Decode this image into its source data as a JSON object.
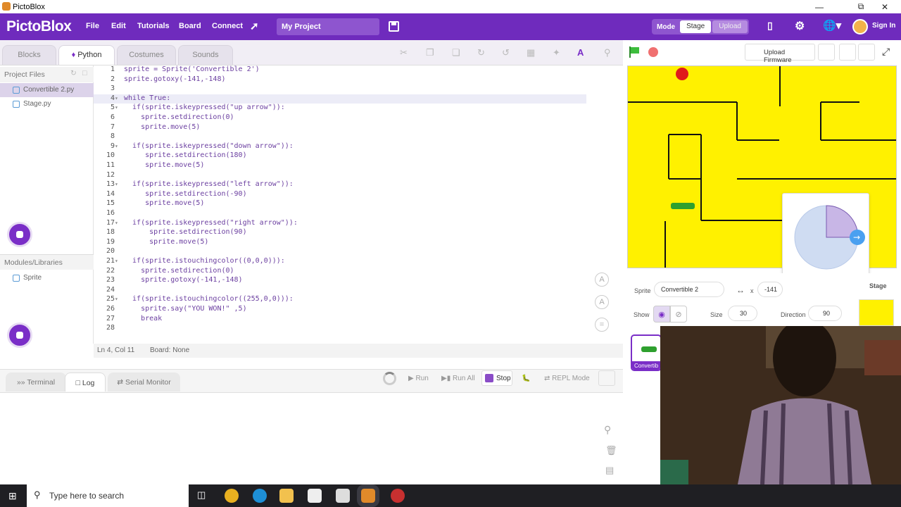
{
  "window": {
    "title": "PictoBlox"
  },
  "menubar": {
    "logo": "PictoBlox",
    "items": [
      "File",
      "Edit",
      "Tutorials",
      "Board",
      "Connect"
    ],
    "project_name": "My Project",
    "mode_label": "Mode",
    "mode_stage": "Stage",
    "mode_upload": "Upload",
    "sign_in": "Sign In"
  },
  "tabs": [
    "Blocks",
    "Python",
    "Costumes",
    "Sounds"
  ],
  "toolbar": {
    "upload_firmware": "Upload Firmware"
  },
  "file_panel": {
    "project_files_header": "Project Files",
    "files": [
      "Convertible 2.py",
      "Stage.py"
    ],
    "modules_header": "Modules/Libraries",
    "modules": [
      "Sprite"
    ]
  },
  "editor": {
    "lines": [
      "sprite = Sprite('Convertible 2')",
      "sprite.gotoxy(-141,-148)",
      "",
      "while True:",
      "  if(sprite.iskeypressed(\"up arrow\")):",
      "    sprite.setdirection(0)",
      "    sprite.move(5)",
      "",
      "  if(sprite.iskeypressed(\"down arrow\")):",
      "     sprite.setdirection(180)",
      "     sprite.move(5)",
      "",
      "  if(sprite.iskeypressed(\"left arrow\")):",
      "     sprite.setdirection(-90)",
      "     sprite.move(5)",
      "",
      "  if(sprite.iskeypressed(\"right arrow\")):",
      "      sprite.setdirection(90)",
      "      sprite.move(5)",
      "",
      "  if(sprite.istouchingcolor((0,0,0))):",
      "    sprite.setdirection(0)",
      "    sprite.gotoxy(-141,-148)",
      "",
      "  if(sprite.istouchingcolor((255,0,0))):",
      "    sprite.say(\"YOU WON!\" ,5)",
      "    break",
      ""
    ],
    "cursor_pos": "Ln 4, Col 11",
    "board": "Board: None"
  },
  "bottom": {
    "tabs": [
      "Terminal",
      "Log",
      "Serial Monitor"
    ],
    "run": "Run",
    "run_all": "Run All",
    "stop": "Stop",
    "repl_mode": "REPL Mode"
  },
  "sprite_panel": {
    "sprite_label": "Sprite",
    "sprite_name": "Convertible 2",
    "x_label": "x",
    "x_value": "-141",
    "show_label": "Show",
    "size_label": "Size",
    "size_value": "30",
    "direction_label": "Direction",
    "direction_value": "90",
    "stage_label": "Stage",
    "sprite_thumb_label": "Convertib"
  },
  "taskbar": {
    "search_placeholder": "Type here to search"
  },
  "colors": {
    "brand": "#6f2bbd",
    "stage_bg": "#fff100",
    "code": "#6b3fa0"
  }
}
